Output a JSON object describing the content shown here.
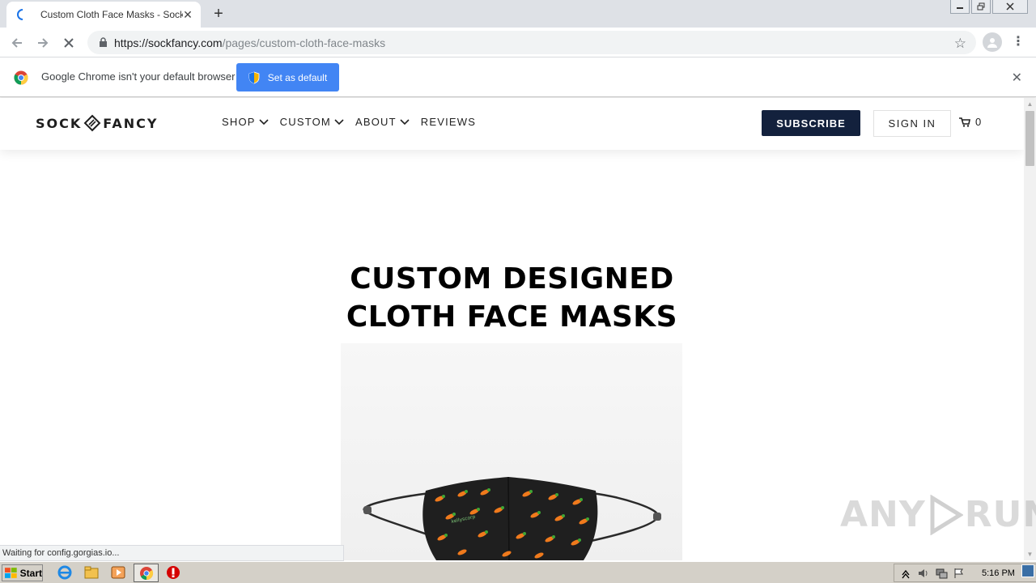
{
  "browser": {
    "tab_title": "Custom Cloth Face Masks - Sock Fancy",
    "new_tab_symbol": "+",
    "url_host": "https://sockfancy.com",
    "url_path": "/pages/custom-cloth-face-masks",
    "infobar_text": "Google Chrome isn't your default browser",
    "infobar_button": "Set as default",
    "status_text": "Waiting for config.gorgias.io..."
  },
  "site": {
    "logo_left": "SOCK",
    "logo_right": "FANCY",
    "nav": [
      {
        "label": "SHOP",
        "has_dropdown": true
      },
      {
        "label": "CUSTOM",
        "has_dropdown": true
      },
      {
        "label": "ABOUT",
        "has_dropdown": true
      },
      {
        "label": "REVIEWS",
        "has_dropdown": false
      }
    ],
    "subscribe_label": "SUBSCRIBE",
    "signin_label": "SIGN IN",
    "cart_count": "0",
    "hero_line1": "CUSTOM DESIGNED",
    "hero_line2": "CLOTH FACE MASKS",
    "mask_brand_text": "kellyscorp"
  },
  "watermark": {
    "text_left": "ANY",
    "text_right": "RUN"
  },
  "taskbar": {
    "start_label": "Start",
    "clock": "5:16 PM"
  },
  "colors": {
    "subscribe_bg": "#13213d",
    "infobar_button_bg": "#4285f4",
    "tabstrip_bg": "#dee1e6"
  }
}
